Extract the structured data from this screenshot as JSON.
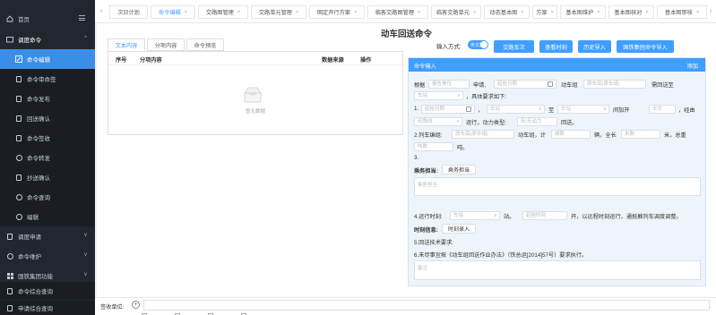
{
  "sidebar": {
    "home": "首页",
    "dispatch_group": "调度命令",
    "items": [
      {
        "label": "命令编辑",
        "active": true,
        "icon": "edit-icon"
      },
      {
        "label": "命令审命签",
        "icon": "doc-icon"
      },
      {
        "label": "命令发布",
        "icon": "doc-icon"
      },
      {
        "label": "回送确认",
        "icon": "doc-icon"
      },
      {
        "label": "命令签收",
        "icon": "doc-icon"
      },
      {
        "label": "命令转发",
        "icon": "circle-icon"
      },
      {
        "label": "抄送确认",
        "icon": "doc-icon"
      },
      {
        "label": "命令查询",
        "icon": "circle-icon"
      },
      {
        "label": "编辑",
        "icon": "circle-icon"
      }
    ],
    "groups": [
      {
        "label": "调度申请"
      },
      {
        "label": "命令维护"
      },
      {
        "label": "国铁集团功能"
      }
    ],
    "tail": [
      {
        "label": "命令综合查询"
      },
      {
        "label": "申请综合查询"
      }
    ]
  },
  "tabs": [
    "次日计划",
    "命令编辑",
    "交路图管理",
    "交路单元管理",
    "固定开行方案",
    "临客交路图管理",
    "临客交路单元",
    "动态基本图",
    "方案",
    "基本图维护",
    "基本图核对",
    "基本图审核"
  ],
  "page": {
    "title": "动车回送命令",
    "input_mode_label": "输入方式:",
    "toggle_text": "传文数",
    "buttons": [
      "交路车次",
      "查看时刻",
      "历史导入",
      "国铁集团命令导入"
    ]
  },
  "left_panel": {
    "tabs": [
      "文本内容",
      "分项内容",
      "命令预览"
    ],
    "columns": [
      "序号",
      "分项内容",
      "数据来源",
      "操作"
    ],
    "empty_text": "暂无数据"
  },
  "form": {
    "header": "命令输入",
    "add": "添加",
    "l1": {
      "a": "根据",
      "p_unit": "报告单位",
      "b": "申请,",
      "p_date": "起始日期",
      "c": "动车组",
      "p_car": "原车底(原车组)",
      "d": "需回送至"
    },
    "l2": {
      "p_station": "车站",
      "a": "，具体要求如下:"
    },
    "l3": {
      "num": "1.",
      "p_start": "起始日期",
      "sep": "，",
      "p_station1": "车站",
      "to": "至",
      "p_station2": "车站",
      "a": "间加开",
      "p_train": "车次",
      "b": "，经由"
    },
    "l4": {
      "p_route": "经路线",
      "a": "运行，动力类型:",
      "p_power": "有/无动力",
      "b": "回送。"
    },
    "l5": {
      "a": "2.列车编组:",
      "p_car": "原车底(原车组)",
      "b": "动车组，计",
      "p_count": "辆数",
      "c": "辆，全长",
      "p_len": "米数",
      "d": "米，总重"
    },
    "l6": {
      "p_weight": "吨数",
      "a": "吨。"
    },
    "l7": {
      "a": "3."
    },
    "duty": {
      "label": "乘务担当:",
      "btn": "乘务担当",
      "placeholder": "乘务担当"
    },
    "l8": {
      "a": "4.运行时刻:",
      "p_station": "车站",
      "b": "站。",
      "p_time": "起始时间",
      "c": "开，以远程时刻运行，通抵触列车调度调整。"
    },
    "timing": {
      "label": "时刻信息:",
      "btn": "时刻录入"
    },
    "l9": {
      "a": "5.回送技术要求:"
    },
    "l10": {
      "a": "6.未尽事宜按《动车组回送作业办法》（铁总运[2014]57号）要求执行。"
    },
    "remark_placeholder": "备注"
  },
  "bottom": {
    "sign_label": "签收单位:"
  },
  "colors": {
    "accent": "#409eff",
    "sidebar_bg": "#22262f",
    "sidebar_active": "#3a8ee6"
  }
}
